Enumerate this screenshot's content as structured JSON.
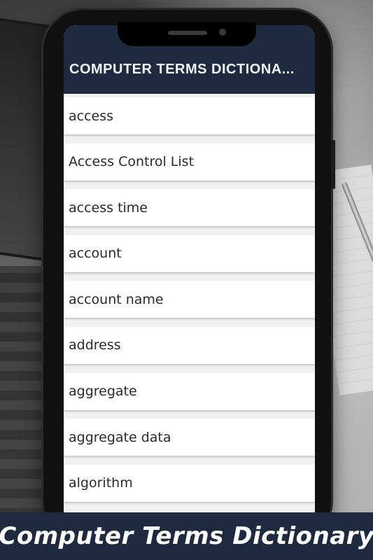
{
  "app": {
    "title": "COMPUTER TERMS DICTIONA..."
  },
  "terms": [
    "access",
    "Access Control List",
    "access time",
    "account",
    "account name",
    "address",
    "aggregate",
    "aggregate data",
    "algorithm"
  ],
  "banner": {
    "text": "Computer Terms Dictionary"
  },
  "colors": {
    "appbar": "#1d2a40",
    "banner": "#1d2a40",
    "list_background": "#f0f0f0",
    "row_background": "#ffffff"
  }
}
